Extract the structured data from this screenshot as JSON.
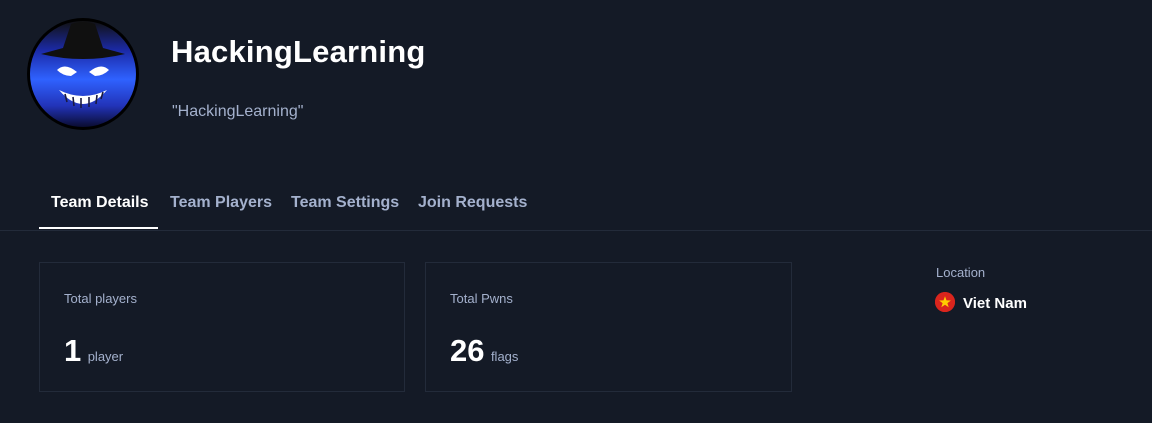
{
  "team": {
    "name": "HackingLearning",
    "motto": "\"HackingLearning\""
  },
  "tabs": [
    {
      "label": "Team Details",
      "active": true
    },
    {
      "label": "Team Players",
      "active": false
    },
    {
      "label": "Team Settings",
      "active": false
    },
    {
      "label": "Join Requests",
      "active": false
    }
  ],
  "stats": {
    "total_players": {
      "label": "Total players",
      "value": "1",
      "unit": "player"
    },
    "total_pwns": {
      "label": "Total Pwns",
      "value": "26",
      "unit": "flags"
    }
  },
  "location": {
    "label": "Location",
    "country": "Viet Nam",
    "flag_icon": "vietnam-flag-icon"
  },
  "colors": {
    "background": "#141a26",
    "muted_text": "#a4b1cd",
    "border": "#232b3a",
    "avatar_blue": "#2a56e8"
  }
}
